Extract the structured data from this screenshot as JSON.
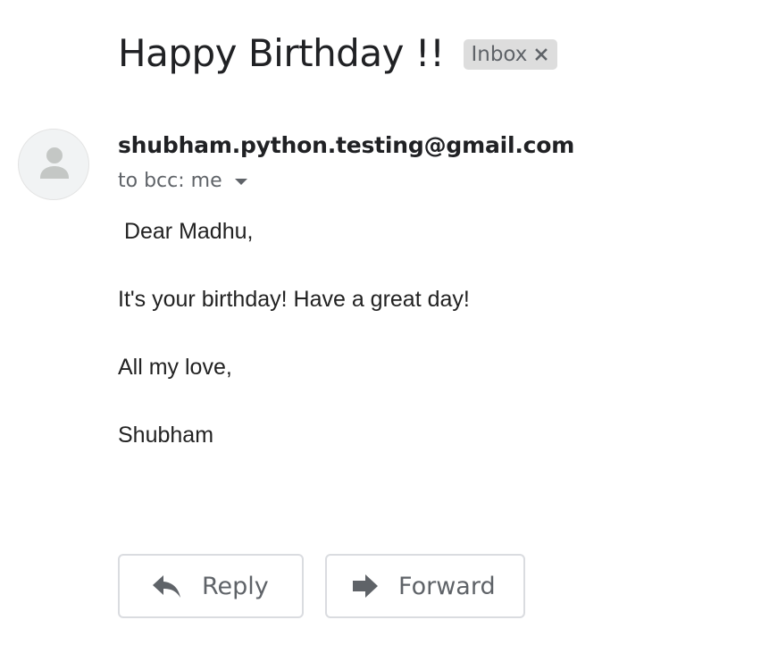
{
  "email": {
    "subject": "Happy Birthday !!",
    "label": "Inbox",
    "sender": "shubham.python.testing@gmail.com",
    "recipients": "to bcc: me",
    "body": {
      "greeting": " Dear Madhu,",
      "line1": "It's your birthday! Have a great day!",
      "closing": "All my love,",
      "signature": "Shubham"
    }
  },
  "actions": {
    "reply_label": "Reply",
    "forward_label": "Forward"
  },
  "icons": {
    "label_remove": "close-icon",
    "avatar": "person-icon",
    "recipients_toggle": "caret-down-icon",
    "reply": "reply-arrow-icon",
    "forward": "forward-arrow-icon"
  },
  "colors": {
    "chip_background": "#dddddd",
    "secondary_text": "#5f6368",
    "button_border": "#dadce0"
  }
}
